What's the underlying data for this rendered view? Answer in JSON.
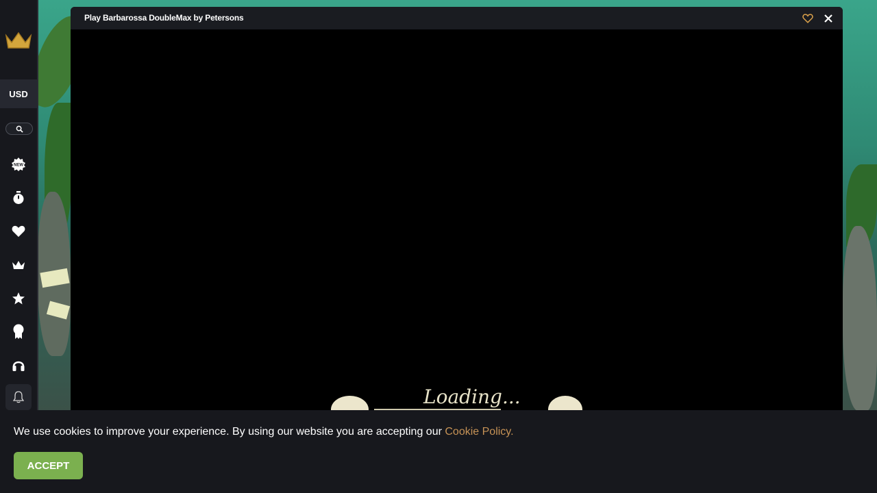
{
  "sidebar": {
    "currency_label": "USD",
    "icons": [
      "crown-logo-icon",
      "search-icon",
      "new-badge-icon",
      "stopwatch-icon",
      "heart-icon",
      "crown-icon",
      "star-icon",
      "medal-icon",
      "headset-icon",
      "bell-icon"
    ]
  },
  "modal": {
    "title": "Play Barbarossa DoubleMax by Petersons",
    "loading_text": "Loading..."
  },
  "cookie": {
    "text": "We use cookies to improve your experience. By using our website you are accepting our ",
    "link_text": "Cookie Policy.",
    "accept_label": "ACCEPT"
  },
  "colors": {
    "accent_gold": "#c79356",
    "accept_green": "#7bb04f",
    "sidebar_bg": "#17181d"
  }
}
